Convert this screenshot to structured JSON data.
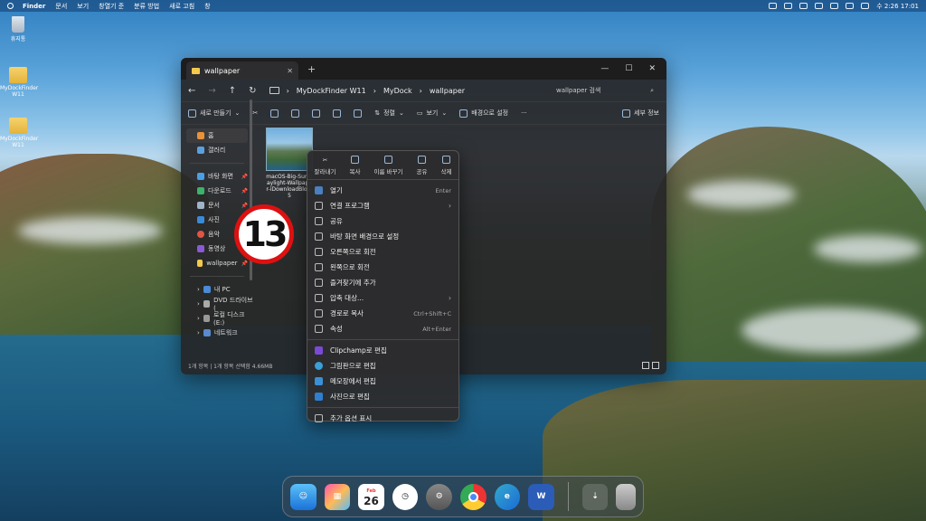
{
  "menubar": {
    "app": "Finder",
    "items": [
      "문서",
      "보기",
      "창열기 준",
      "분류 방법",
      "새로 고침",
      "창"
    ],
    "clock": "수 2:26 17:01"
  },
  "desktop": {
    "icons": [
      {
        "label": "휴지통"
      },
      {
        "label": "MyDockFinder W11"
      },
      {
        "label": "MyDockFinder W11"
      }
    ]
  },
  "explorer": {
    "tab_title": "wallpaper",
    "breadcrumbs": [
      "MyDockFinder W11",
      "MyDock",
      "wallpaper"
    ],
    "search_placeholder": "wallpaper 검색",
    "toolbar": {
      "new": "새로 만들기",
      "sort": "정렬",
      "view": "보기",
      "set_bg": "배경으로 설정",
      "more": "···",
      "details": "세부 정보"
    },
    "sidebar": {
      "home": "홈",
      "gallery": "갤러리",
      "pinned": [
        "바탕 화면",
        "다운로드",
        "문서",
        "사진",
        "음악",
        "동영상",
        "wallpaper"
      ],
      "drives": [
        "내 PC",
        "DVD 드라이브 (",
        "로컬 디스크 (E:)",
        "네트워크"
      ]
    },
    "file": {
      "name": "macOS-Big-Sur-Daylight-Wallpaper-iDownloadBlog-5"
    },
    "status": "1개 항목  |  1개 항목 선택함 4.66MB"
  },
  "context_menu": {
    "quick": [
      "잘라내기",
      "복사",
      "이름 바꾸기",
      "공유",
      "삭제"
    ],
    "items": [
      {
        "label": "열기",
        "shortcut": "Enter"
      },
      {
        "label": "연결 프로그램",
        "arrow": "›"
      },
      {
        "label": "공유"
      },
      {
        "label": "바탕 화면 배경으로 설정"
      },
      {
        "label": "오른쪽으로 회전"
      },
      {
        "label": "왼쪽으로 회전"
      },
      {
        "label": "즐겨찾기에 추가"
      },
      {
        "label": "압축 대상...",
        "arrow": "›"
      },
      {
        "label": "경로로 복사",
        "shortcut": "Ctrl+Shift+C"
      },
      {
        "label": "속성",
        "shortcut": "Alt+Enter"
      },
      {
        "label": "Clipchamp로 편집"
      },
      {
        "label": "그림판으로 편집"
      },
      {
        "label": "메모장에서 편집"
      },
      {
        "label": "사진으로 편집"
      },
      {
        "label": "추가 옵션 표시"
      }
    ]
  },
  "badge": "13",
  "dock": {
    "calendar_month": "Feb",
    "calendar_day": "26"
  },
  "colors": {
    "badge_ring": "#dd1111",
    "folder": "#f2c94c",
    "accent": "#4a7fc0"
  }
}
